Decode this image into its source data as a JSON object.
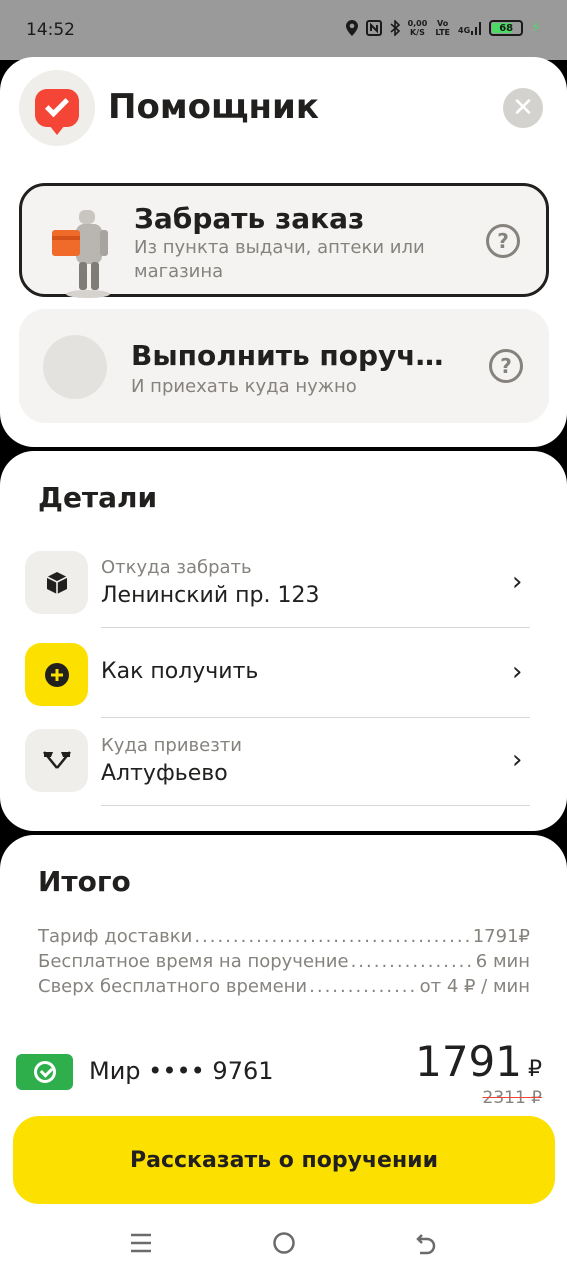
{
  "status_bar": {
    "time": "14:52",
    "net_speed_top": "0,00",
    "net_speed_bottom": "K/S",
    "volte_top": "Vo",
    "volte_bottom": "LTE",
    "signal_label": "4G",
    "battery": "68"
  },
  "header": {
    "title": "Помощник",
    "close_icon": "close-icon"
  },
  "options": [
    {
      "title": "Забрать заказ",
      "subtitle": "Из пункта выдачи, аптеки или магазина",
      "selected": true,
      "help": "?"
    },
    {
      "title": "Выполнить поручен...",
      "subtitle": "И приехать куда нужно",
      "selected": false,
      "help": "?"
    }
  ],
  "details": {
    "title": "Детали",
    "rows": [
      {
        "label": "Откуда забрать",
        "value": "Ленинский пр. 123",
        "icon": "box-icon"
      },
      {
        "label": "",
        "value": "Как получить",
        "icon": "plus-icon"
      },
      {
        "label": "Куда привезти",
        "value": "Алтуфьево",
        "icon": "flags-icon"
      }
    ]
  },
  "totals": {
    "title": "Итого",
    "lines": [
      {
        "name": "Тариф доставки",
        "value": "1791₽"
      },
      {
        "name": "Бесплатное время на поручение",
        "value": "6 мин"
      },
      {
        "name": "Сверх бесплатного времени",
        "value": "от 4 ₽ / мин"
      }
    ],
    "payment": "Мир •••• 9761",
    "price": "1791",
    "currency": "₽",
    "old_price": "2311 ₽",
    "cta": "Рассказать о поручении"
  },
  "colors": {
    "accent_yellow": "#fce000",
    "brand_red": "#f44536",
    "pay_green": "#2eaf4c"
  }
}
